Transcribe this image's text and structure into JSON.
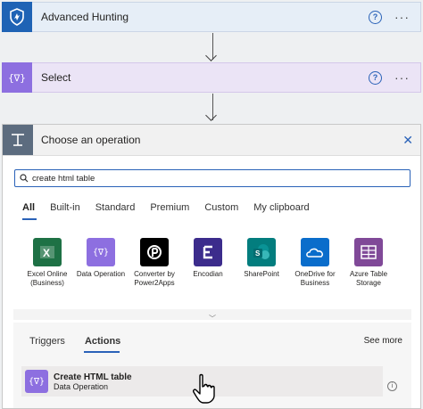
{
  "steps": {
    "hunting": {
      "title": "Advanced Hunting",
      "help": "?",
      "more": "···",
      "icon": "shield-icon",
      "color": "#1f63b5"
    },
    "select": {
      "title": "Select",
      "help": "?",
      "more": "···",
      "icon": "data-operation-icon",
      "color": "#8d6fe0"
    }
  },
  "panel": {
    "title": "Choose an operation",
    "search_value": "create html table",
    "category_tabs": [
      "All",
      "Built-in",
      "Standard",
      "Premium",
      "Custom",
      "My clipboard"
    ],
    "connectors": [
      {
        "label": "Excel Online (Business)",
        "icon": "excel-icon",
        "color": "#1e7145"
      },
      {
        "label": "Data Operation",
        "icon": "data-operation-icon",
        "color": "#8d6fe0"
      },
      {
        "label": "Converter by Power2Apps",
        "icon": "converter-icon",
        "color": "#000000"
      },
      {
        "label": "Encodian",
        "icon": "encodian-icon",
        "color": "#3c2c8c"
      },
      {
        "label": "SharePoint",
        "icon": "sharepoint-icon",
        "color": "#037d7e"
      },
      {
        "label": "OneDrive for Business",
        "icon": "onedrive-icon",
        "color": "#0a6dcb"
      },
      {
        "label": "Azure Table Storage",
        "icon": "azure-table-icon",
        "color": "#804998"
      }
    ],
    "result_tabs": [
      "Triggers",
      "Actions"
    ],
    "see_more": "See more",
    "action": {
      "name": "Create HTML table",
      "connector": "Data Operation"
    }
  }
}
